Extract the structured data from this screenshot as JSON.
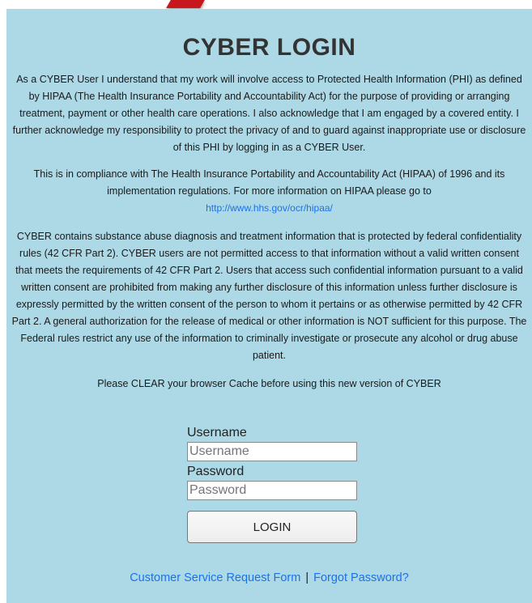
{
  "page": {
    "title": "CYBER LOGIN"
  },
  "disclaimer": {
    "paragraph1": "As a CYBER User I understand that my work will involve access to Protected Health Information (PHI) as defined by HIPAA (The Health Insurance Portability and Accountability Act) for the purpose of providing or arranging treatment, payment or other health care operations. I also acknowledge that I am engaged by a covered entity. I further acknowledge my responsibility to protect the privacy of and to guard against inappropriate use or disclosure of this PHI by logging in as a CYBER User.",
    "paragraph2": "This is in compliance with The Health Insurance Portability and Accountability Act (HIPAA) of 1996 and its implementation regulations. For more information on HIPAA please go to",
    "hipaa_link": "http://www.hhs.gov/ocr/hipaa/",
    "paragraph3": "CYBER contains substance abuse diagnosis and treatment information that is protected by federal confidentiality rules (42 CFR Part 2). CYBER users are not permitted access to that information without a valid written consent that meets the requirements of 42 CFR Part 2. Users that access such confidential information pursuant to a valid written consent are prohibited from making any further disclosure of this information unless further disclosure is expressly permitted by the written consent of the person to whom it pertains or as otherwise permitted by 42 CFR Part 2. A general authorization for the release of medical or other information is NOT sufficient for this purpose. The Federal rules restrict any use of the information to criminally investigate or prosecute any alcohol or drug abuse patient."
  },
  "notice": "Please CLEAR your browser Cache before using this new version of CYBER",
  "form": {
    "username_label": "Username",
    "username_placeholder": "Username",
    "username_value": "",
    "password_label": "Password",
    "password_placeholder": "Password",
    "password_value": "",
    "login_button": "LOGIN"
  },
  "footer": {
    "customer_service_link": "Customer Service Request Form",
    "separator": "|",
    "forgot_password_link": "Forgot Password?"
  },
  "colors": {
    "panel_background": "#add8e6",
    "link": "#1a73e8",
    "arrow": "#c8161d"
  },
  "icons": {
    "arrow": "red-arrow-icon"
  }
}
